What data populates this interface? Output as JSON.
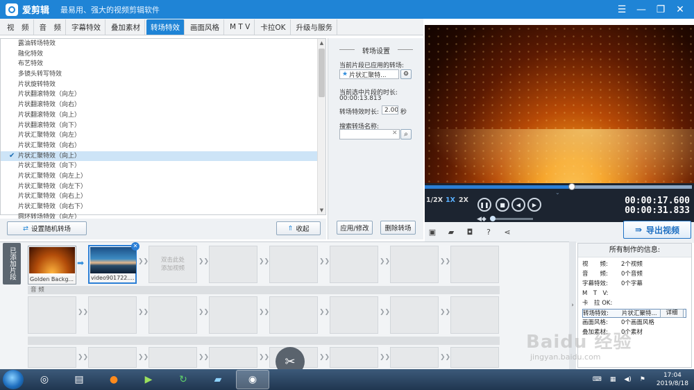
{
  "window": {
    "title": "爱剪辑",
    "subtitle": "最易用、强大的视频剪辑软件",
    "buttons": [
      "☰",
      "—",
      "❐",
      "✕"
    ]
  },
  "tabs": [
    "视　频",
    "音　频",
    "字幕特效",
    "叠加素材",
    "转场特效",
    "画面风格",
    "M T V",
    "卡拉OK",
    "升级与服务"
  ],
  "active_tab": 4,
  "transition_list": {
    "items": [
      "露油转场特效",
      "融化特效",
      "布艺特效",
      "多镜头转写特效",
      "片状旋转特效",
      "片状翻滚特效（向左）",
      "片状翻滚特效（向右）",
      "片状翻滚特效（向上）",
      "片状翻滚特效（向下）",
      "片状汇聚特效（向左）",
      "片状汇聚特效（向右）",
      "片状汇聚特效（向上）",
      "片状汇聚特效（向下）",
      "片状汇聚特效（向左上）",
      "片状汇聚特效（向左下）",
      "片状汇聚特效（向右上）",
      "片状汇聚特效（向右下）",
      "圆环转场特效（向左）"
    ],
    "selected_index": 11
  },
  "list_buttons": {
    "random": "设置随机转场",
    "collapse": "收起"
  },
  "settings": {
    "title": "转场设置",
    "applied_label": "当前片段已应用的转场:",
    "applied_value": "片状汇聚特...",
    "duration_label": "当前选中片段的时长:",
    "duration_value": "00:00:13.813",
    "effect_len_label": "转场特效时长:",
    "effect_len_value": "2.00",
    "effect_len_unit": "秒",
    "search_label": "搜索转场名称:",
    "search_value": "",
    "apply_button": "应用/修改",
    "delete_button": "删除转场"
  },
  "player": {
    "speeds": [
      "1/2X",
      "1X",
      "2X"
    ],
    "active_speed": 1,
    "current_time": "00:00:17.600",
    "total_time": "00:00:31.833",
    "progress": 0.55,
    "volume": 0.0,
    "export_button": "导出视频"
  },
  "timeline": {
    "side_label": "已添加片段",
    "clips": [
      {
        "name": "Golden Backg..."
      },
      {
        "name": "video901722...."
      }
    ],
    "add_hint": "双击此处\n添加视频",
    "audio_label": "音 频"
  },
  "info": {
    "title": "所有制作的信息:",
    "rows": [
      {
        "k": "视　　频:",
        "v": "2个视频"
      },
      {
        "k": "音　　频:",
        "v": "0个音频"
      },
      {
        "k": "字幕特效:",
        "v": "0个字幕"
      },
      {
        "k": "M　T　V:",
        "v": ""
      },
      {
        "k": "卡　拉 OK:",
        "v": ""
      },
      {
        "k": "转场特效:",
        "v": "片状汇聚特..."
      },
      {
        "k": "画面风格:",
        "v": "0个画面风格"
      },
      {
        "k": "叠加素材:",
        "v": "0个素材"
      }
    ],
    "detail_button": "详细"
  },
  "taskbar": {
    "time": "17:04",
    "date": "2019/8/18"
  },
  "watermark": {
    "text": "Baidu 经验",
    "url": "jingyan.baidu.com"
  }
}
